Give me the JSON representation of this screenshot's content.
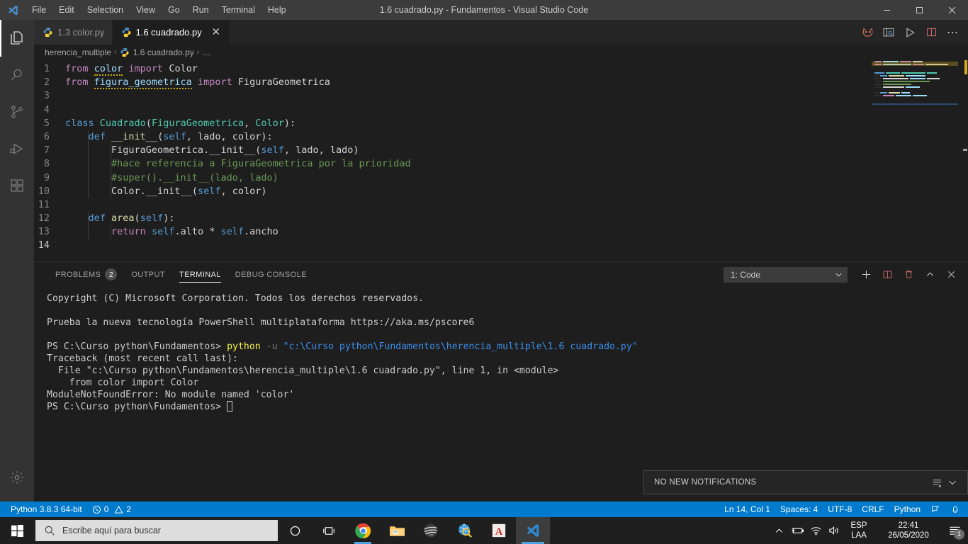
{
  "window": {
    "title": "1.6 cuadrado.py - Fundamentos - Visual Studio Code",
    "minimize_label": "–",
    "maximize_label": "❐",
    "close_label": "✕"
  },
  "menubar": {
    "items": [
      {
        "label": "File"
      },
      {
        "label": "Edit"
      },
      {
        "label": "Selection"
      },
      {
        "label": "View"
      },
      {
        "label": "Go"
      },
      {
        "label": "Run"
      },
      {
        "label": "Terminal"
      },
      {
        "label": "Help"
      }
    ]
  },
  "activitybar": {
    "items": [
      {
        "icon": "files-explorer-icon",
        "active": true
      },
      {
        "icon": "search-icon",
        "active": false
      },
      {
        "icon": "source-control-icon",
        "active": false
      },
      {
        "icon": "run-and-debug-icon",
        "active": false
      },
      {
        "icon": "extensions-icon",
        "active": false
      }
    ],
    "settings_icon": "gear-icon"
  },
  "tabs": [
    {
      "label": "1.3 color.py",
      "active": false,
      "icon": "python-file-icon",
      "closable": false
    },
    {
      "label": "1.6 cuadrado.py",
      "active": true,
      "icon": "python-file-icon",
      "closable": true,
      "close_label": "✕"
    }
  ],
  "editor_actions": [
    {
      "icon": "gitlens-cat-icon"
    },
    {
      "icon": "open-preview-icon"
    },
    {
      "icon": "run-python-file-icon"
    },
    {
      "icon": "split-editor-icon"
    },
    {
      "icon": "more-actions-icon",
      "label": "⋯"
    }
  ],
  "breadcrumb": {
    "parts": [
      "herencia_multiple",
      "1.6 cuadrado.py",
      "…"
    ],
    "separator": "›"
  },
  "code": {
    "lines": [
      {
        "n": "1",
        "tokens": [
          {
            "t": "from ",
            "c": "k"
          },
          {
            "t": "color",
            "c": "id squig"
          },
          {
            "t": " ",
            "c": "op"
          },
          {
            "t": "import",
            "c": "k"
          },
          {
            "t": " Color",
            "c": "op"
          }
        ]
      },
      {
        "n": "2",
        "tokens": [
          {
            "t": "from ",
            "c": "k"
          },
          {
            "t": "figura_geometrica",
            "c": "id squig"
          },
          {
            "t": " ",
            "c": "op"
          },
          {
            "t": "import",
            "c": "k"
          },
          {
            "t": " FiguraGeometrica",
            "c": "op"
          }
        ]
      },
      {
        "n": "3",
        "tokens": []
      },
      {
        "n": "4",
        "tokens": []
      },
      {
        "n": "5",
        "tokens": [
          {
            "t": "class ",
            "c": "kb"
          },
          {
            "t": "Cuadrado",
            "c": "ty"
          },
          {
            "t": "(",
            "c": "op"
          },
          {
            "t": "FiguraGeometrica",
            "c": "ty"
          },
          {
            "t": ", ",
            "c": "op"
          },
          {
            "t": "Color",
            "c": "ty"
          },
          {
            "t": "):",
            "c": "op"
          }
        ]
      },
      {
        "n": "6",
        "tokens": [
          {
            "t": "    ",
            "c": "op"
          },
          {
            "t": "def ",
            "c": "kb"
          },
          {
            "t": "__init__",
            "c": "fn"
          },
          {
            "t": "(",
            "c": "op"
          },
          {
            "t": "self",
            "c": "kb"
          },
          {
            "t": ", lado, color):",
            "c": "op"
          }
        ]
      },
      {
        "n": "7",
        "tokens": [
          {
            "t": "        FiguraGeometrica.",
            "c": "op"
          },
          {
            "t": "__init__",
            "c": "op"
          },
          {
            "t": "(",
            "c": "op"
          },
          {
            "t": "self",
            "c": "kb"
          },
          {
            "t": ", lado, lado)",
            "c": "op"
          }
        ]
      },
      {
        "n": "8",
        "tokens": [
          {
            "t": "        #hace referencia a FiguraGeometrica por la prioridad",
            "c": "cm"
          }
        ]
      },
      {
        "n": "9",
        "tokens": [
          {
            "t": "        #super().__init__(lado, lado)",
            "c": "cm"
          }
        ]
      },
      {
        "n": "10",
        "tokens": [
          {
            "t": "        Color.",
            "c": "op"
          },
          {
            "t": "__init__",
            "c": "op"
          },
          {
            "t": "(",
            "c": "op"
          },
          {
            "t": "self",
            "c": "kb"
          },
          {
            "t": ", color)",
            "c": "op"
          }
        ]
      },
      {
        "n": "11",
        "tokens": []
      },
      {
        "n": "12",
        "tokens": [
          {
            "t": "    ",
            "c": "op"
          },
          {
            "t": "def ",
            "c": "kb"
          },
          {
            "t": "area",
            "c": "fn"
          },
          {
            "t": "(",
            "c": "op"
          },
          {
            "t": "self",
            "c": "kb"
          },
          {
            "t": "):",
            "c": "op"
          }
        ]
      },
      {
        "n": "13",
        "tokens": [
          {
            "t": "        ",
            "c": "op"
          },
          {
            "t": "return ",
            "c": "k"
          },
          {
            "t": "self",
            "c": "kb"
          },
          {
            "t": ".alto ",
            "c": "op"
          },
          {
            "t": "*",
            "c": "op"
          },
          {
            "t": " ",
            "c": "op"
          },
          {
            "t": "self",
            "c": "kb"
          },
          {
            "t": ".ancho",
            "c": "op"
          }
        ]
      },
      {
        "n": "14",
        "tokens": [],
        "current": true
      }
    ]
  },
  "panel": {
    "tabs": [
      {
        "label": "PROBLEMS",
        "active": false,
        "badge": "2"
      },
      {
        "label": "OUTPUT",
        "active": false
      },
      {
        "label": "TERMINAL",
        "active": true
      },
      {
        "label": "DEBUG CONSOLE",
        "active": false
      }
    ],
    "terminal_selector": {
      "value": "1: Code",
      "chevron": "⌄"
    },
    "actions": [
      {
        "icon": "new-terminal-icon",
        "label": "+"
      },
      {
        "icon": "split-terminal-icon"
      },
      {
        "icon": "kill-terminal-icon"
      },
      {
        "icon": "maximize-panel-icon",
        "label": "⌃"
      },
      {
        "icon": "close-panel-icon",
        "label": "✕"
      }
    ],
    "terminal_lines": [
      {
        "parts": [
          {
            "t": "Copyright (C) Microsoft Corporation. Todos los derechos reservados.",
            "c": "t-white"
          }
        ]
      },
      {
        "parts": [
          {
            "t": "",
            "c": "t-white"
          }
        ]
      },
      {
        "parts": [
          {
            "t": "Prueba la nueva tecnología PowerShell multiplataforma https://aka.ms/pscore6",
            "c": "t-white"
          }
        ]
      },
      {
        "parts": [
          {
            "t": "",
            "c": "t-white"
          }
        ]
      },
      {
        "parts": [
          {
            "t": "PS C:\\Curso python\\Fundamentos> ",
            "c": "t-white"
          },
          {
            "t": "python",
            "c": "t-yellow"
          },
          {
            "t": " ",
            "c": "t-white"
          },
          {
            "t": "-u",
            "c": "t-gray"
          },
          {
            "t": " ",
            "c": "t-white"
          },
          {
            "t": "\"c:\\Curso python\\Fundamentos\\herencia_multiple\\1.6 cuadrado.py\"",
            "c": "t-cyan"
          }
        ]
      },
      {
        "parts": [
          {
            "t": "Traceback (most recent call last):",
            "c": "t-white"
          }
        ]
      },
      {
        "parts": [
          {
            "t": "  File \"c:\\Curso python\\Fundamentos\\herencia_multiple\\1.6 cuadrado.py\", line 1, in <module>",
            "c": "t-white"
          }
        ]
      },
      {
        "parts": [
          {
            "t": "    from color import Color",
            "c": "t-white"
          }
        ]
      },
      {
        "parts": [
          {
            "t": "ModuleNotFoundError: No module named 'color'",
            "c": "t-white"
          }
        ]
      },
      {
        "parts": [
          {
            "t": "PS C:\\Curso python\\Fundamentos> ",
            "c": "t-white"
          },
          {
            "t": "█",
            "c": "t-cursor"
          }
        ]
      }
    ]
  },
  "notification_toast": {
    "label": "NO NEW NOTIFICATIONS",
    "clear_icon": "clear-all-notifications-icon",
    "collapse_icon": "chevron-down-icon"
  },
  "statusbar": {
    "left": [
      {
        "label": "Python 3.8.3 64-bit",
        "name": "python-interpreter"
      },
      {
        "label": "0",
        "name": "errors-count",
        "icon": "error-circle-icon",
        "extra": "2",
        "extra_icon": "warning-triangle-icon"
      }
    ],
    "errors": "0",
    "warnings": "2",
    "right": [
      {
        "label": "Ln 14, Col 1",
        "name": "cursor-position"
      },
      {
        "label": "Spaces: 4",
        "name": "indentation"
      },
      {
        "label": "UTF-8",
        "name": "encoding"
      },
      {
        "label": "CRLF",
        "name": "eol"
      },
      {
        "label": "Python",
        "name": "language-mode"
      }
    ],
    "feedback_icon": "feedback-smiley-icon",
    "bell_icon": "notifications-bell-icon"
  },
  "taskbar": {
    "start_icon": "windows-start-icon",
    "search_placeholder": "Escribe aquí para buscar",
    "search_icon": "search-icon",
    "items": [
      {
        "name": "cortana",
        "running": false
      },
      {
        "name": "task-view",
        "running": false
      },
      {
        "name": "google-chrome",
        "running": true
      },
      {
        "name": "file-explorer",
        "running": false
      },
      {
        "name": "dark-app",
        "running": false
      },
      {
        "name": "search-globe-app",
        "running": false
      },
      {
        "name": "autocad",
        "running": false
      },
      {
        "name": "visual-studio-code",
        "running": true,
        "active": true
      }
    ],
    "tray": {
      "show_hidden_icon": "chevron-up-icon",
      "battery_icon": "battery-icon",
      "network_icon": "wifi-icon",
      "volume_icon": "volume-icon",
      "language_top": "ESP",
      "language_bottom": "LAA",
      "time": "22:41",
      "date": "26/05/2020",
      "notification_icon": "action-center-icon",
      "notification_count": "1"
    }
  },
  "colors": {
    "accent": "#007acc",
    "titlebar": "#3c3c3c",
    "editor_bg": "#1e1e1e",
    "activitybar": "#333333",
    "tabbar": "#252526",
    "taskbar": "#1f1f1f"
  }
}
